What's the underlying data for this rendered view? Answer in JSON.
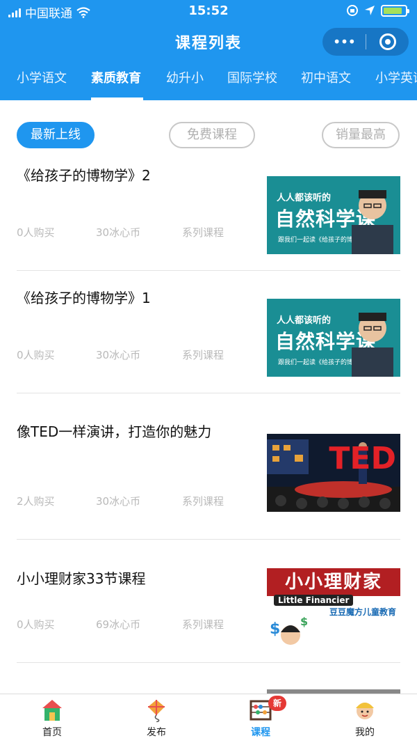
{
  "status_bar": {
    "carrier": "中国联通",
    "time": "15:52",
    "battery_level": 0.85
  },
  "header": {
    "title": "课程列表",
    "more_label": "•••"
  },
  "tabs": [
    {
      "label": "小学语文"
    },
    {
      "label": "素质教育",
      "active": true
    },
    {
      "label": "幼升小"
    },
    {
      "label": "国际学校"
    },
    {
      "label": "初中语文"
    },
    {
      "label": "小学英语"
    }
  ],
  "filters": [
    {
      "label": "最新上线",
      "active": true
    },
    {
      "label": "免费课程"
    },
    {
      "label": "销量最高"
    }
  ],
  "courses": [
    {
      "name": "《给孩子的博物学》2",
      "purchases": "0人购买",
      "price": "30冰心币",
      "type": "系列课程",
      "thumb": {
        "style": "nature",
        "line1": "人人都该听的",
        "line2": "自然科学课",
        "line3": "跟我们一起读《给孩子的博物学》"
      }
    },
    {
      "name": "《给孩子的博物学》1",
      "purchases": "0人购买",
      "price": "30冰心币",
      "type": "系列课程",
      "thumb": {
        "style": "nature",
        "line1": "人人都该听的",
        "line2": "自然科学课",
        "line3": "跟我们一起读《给孩子的博物学》"
      }
    },
    {
      "name": "像TED一样演讲，打造你的魅力",
      "purchases": "2人购买",
      "price": "30冰心币",
      "type": "系列课程",
      "thumb": {
        "style": "ted",
        "line1": "TED"
      }
    },
    {
      "name": "小小理财家33节课程",
      "purchases": "0人购买",
      "price": "69冰心币",
      "type": "系列课程",
      "thumb": {
        "style": "fin",
        "line1": "小小理财家",
        "line2": "Little Financier",
        "line3": "豆豆魔方儿童教育"
      }
    }
  ],
  "bottom_nav": [
    {
      "label": "首页",
      "icon": "home-icon"
    },
    {
      "label": "发布",
      "icon": "kite-icon"
    },
    {
      "label": "课程",
      "icon": "abacus-icon",
      "active": true,
      "badge": "新"
    },
    {
      "label": "我的",
      "icon": "avatar-icon"
    }
  ],
  "colors": {
    "primary": "#1f96ef",
    "badge": "#e53935"
  }
}
